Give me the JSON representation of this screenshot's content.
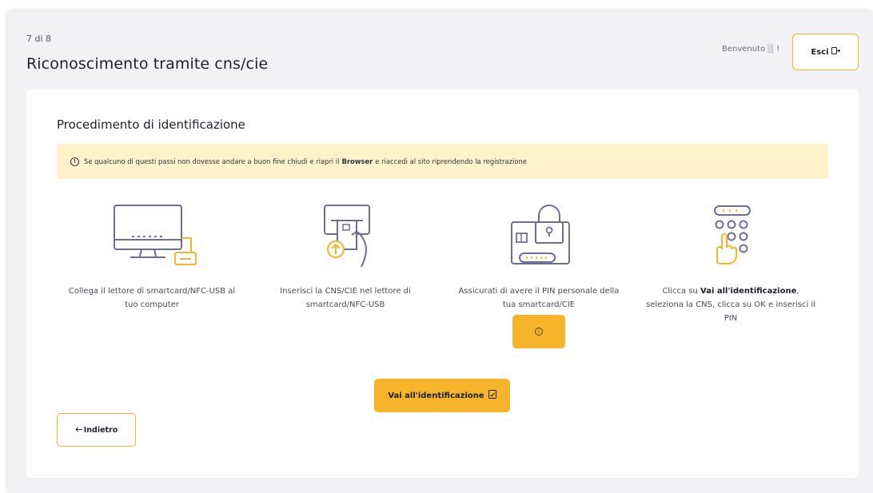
{
  "header": {
    "step": "7 di 8",
    "title": "Riconoscimento tramite cns/cie",
    "welcome": "Benvenuto ░ !",
    "exit_label": "Esci",
    "exit_icon": "exit-icon"
  },
  "card": {
    "section_title": "Procedimento di identificazione",
    "warning": {
      "icon": "info-circle-icon",
      "text_before": "Se qualcuno di questi passi non dovesse andare a buon fine chiudi e riapri il",
      "bold": "Browser",
      "text_after": "e riaccedi al sito riprendendo la registrazione"
    },
    "steps": [
      {
        "icon": "computer-card-reader-icon",
        "text": "Collega il lettore di smartcard/NFC-USB al tuo computer"
      },
      {
        "icon": "insert-card-icon",
        "text": "Inserisci la CNS/CIE nel lettore di smartcard/NFC-USB"
      },
      {
        "icon": "locked-card-pin-icon",
        "text": "Assicurati di avere il PIN personale della tua smartcard/CIE"
      },
      {
        "icon": "keypad-pin-icon",
        "text_before": "Clicca su",
        "text_bold": "Vai all'identificazione",
        "text_after": ", seleziona la CNS, clicca su OK e inserisci il PIN"
      }
    ],
    "info_button_icon": "info-circle-icon",
    "go_button_label": "Vai all'identificazione",
    "go_button_icon": "checklist-icon",
    "back_button_label": "Indietro",
    "back_button_icon": "arrow-left-icon"
  },
  "colors": {
    "accent": "#f5b42a",
    "warning_bg": "#fdf2c9",
    "icon_stroke": "#6b6f96",
    "page_bg": "#f2f2f5"
  }
}
